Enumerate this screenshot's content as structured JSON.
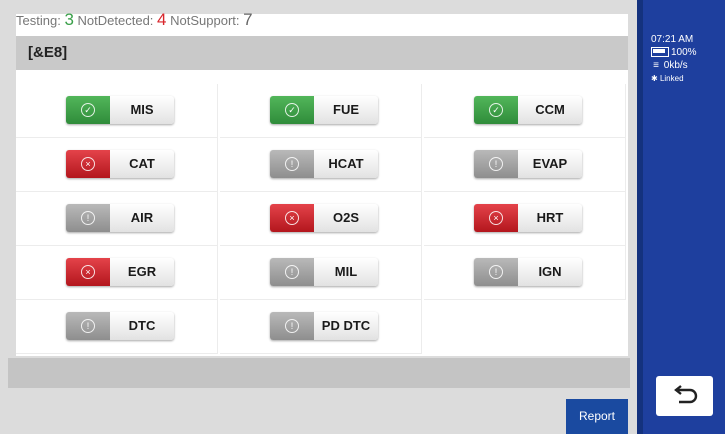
{
  "summary": {
    "testing_label": "Testing:",
    "testing_count": "3",
    "not_detected_label": "NotDetected:",
    "not_detected_count": "4",
    "not_support_label": "NotSupport:",
    "not_support_count": "7"
  },
  "group": {
    "title": "[&E8]"
  },
  "monitors": [
    {
      "label": "MIS",
      "status": "passed"
    },
    {
      "label": "FUE",
      "status": "passed"
    },
    {
      "label": "CCM",
      "status": "passed"
    },
    {
      "label": "CAT",
      "status": "failed"
    },
    {
      "label": "HCAT",
      "status": "not-supported"
    },
    {
      "label": "EVAP",
      "status": "not-supported"
    },
    {
      "label": "AIR",
      "status": "not-supported"
    },
    {
      "label": "O2S",
      "status": "failed"
    },
    {
      "label": "HRT",
      "status": "failed"
    },
    {
      "label": "EGR",
      "status": "failed"
    },
    {
      "label": "MIL",
      "status": "not-supported"
    },
    {
      "label": "IGN",
      "status": "not-supported"
    },
    {
      "label": "DTC",
      "status": "not-supported"
    },
    {
      "label": "PD DTC",
      "status": "not-supported"
    }
  ],
  "icons": {
    "passed": "check-circle-icon",
    "failed": "x-circle-icon",
    "not-supported": "info-circle-icon"
  },
  "colors": {
    "passed": "#3aa04a",
    "failed": "#d8262c",
    "not-supported": "#9a9a9a",
    "sidebar": "#1e3f9e"
  },
  "footer": {
    "report_label": "Report"
  },
  "sidebar": {
    "time": "07:21 AM",
    "battery": "100%",
    "speed": "0kb/s",
    "link_status": "Linked"
  }
}
